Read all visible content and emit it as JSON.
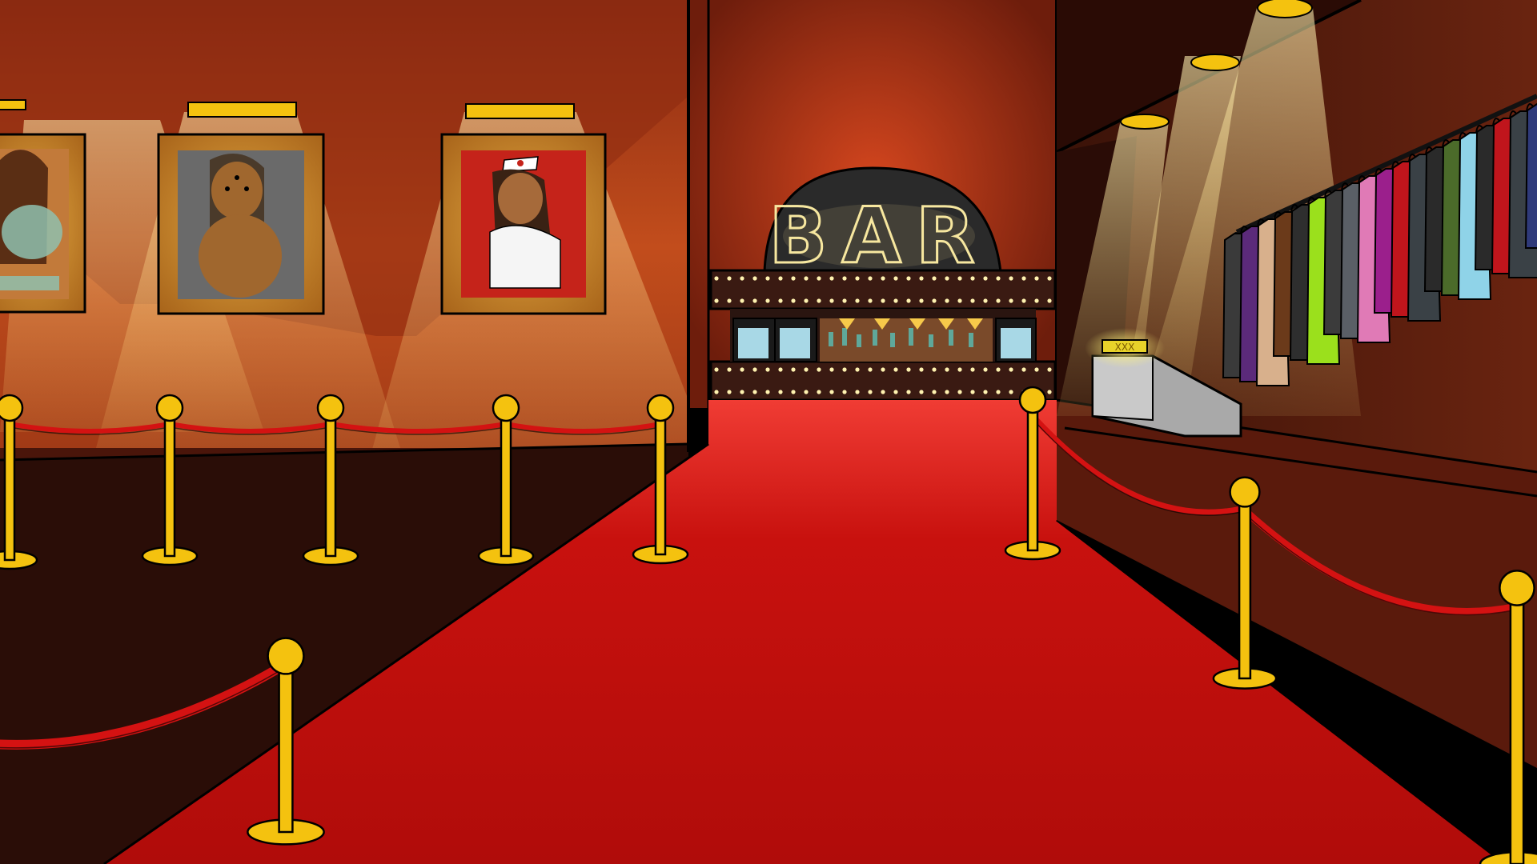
{
  "scene": {
    "name": "club-lobby",
    "bar_sign": {
      "text": "BAR"
    },
    "register_plate": {
      "text": "XXX"
    },
    "portraits": [
      {
        "subject": "woman-portrait-teal-lingerie"
      },
      {
        "subject": "woman-portrait-three-eyed"
      },
      {
        "subject": "woman-portrait-nurse"
      }
    ],
    "colors": {
      "wall_left": "#b5431d",
      "wall_center": "#9c2f14",
      "wall_right": "#5a1a0d",
      "carpet": "#c4100e",
      "floor_dark": "#2a0d07",
      "brass": "#f4c20f",
      "rope": "#d41212",
      "spotlight": "#f7d98a",
      "marquee_bulb": "#fff3b0"
    },
    "coat_colors": [
      "#3a3a3a",
      "#5b2a7a",
      "#d8b08c",
      "#6b3a1a",
      "#2e2e2e",
      "#9be01c",
      "#3b3b3b",
      "#5a5f66",
      "#e07ab6",
      "#9b1f8c",
      "#c0151c",
      "#3a4146",
      "#2a2a2a",
      "#4b6b2a",
      "#8fd3e8",
      "#2a2a2a",
      "#c0151c",
      "#3a4146",
      "#2f3a7a"
    ]
  }
}
